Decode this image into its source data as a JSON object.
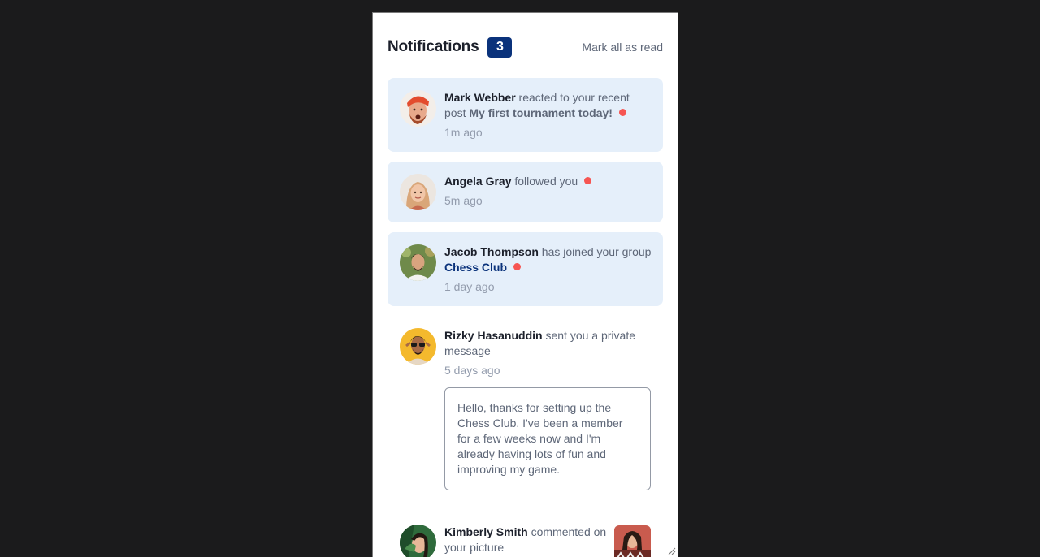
{
  "header": {
    "title": "Notifications",
    "unread_count": "3",
    "mark_all_label": "Mark all as read"
  },
  "notifications": [
    {
      "name": "Mark Webber",
      "action": " reacted to your recent post ",
      "target": "My first tournament today!",
      "time": "1m ago",
      "unread": true
    },
    {
      "name": "Angela Gray",
      "action": " followed you",
      "time": "5m ago",
      "unread": true
    },
    {
      "name": "Jacob Thompson",
      "action": " has joined your group ",
      "target": "Chess Club",
      "time": "1 day ago",
      "unread": true
    },
    {
      "name": "Rizky Hasanuddin",
      "action": " sent you a private message",
      "time": "5 days ago",
      "unread": false,
      "message": "Hello, thanks for setting up the Chess Club. I've been a member for a few weeks now and I'm already having lots of fun and improving my game."
    },
    {
      "name": "Kimberly Smith",
      "action": " commented on your picture",
      "unread": false
    }
  ],
  "colors": {
    "page_bg": "#1b1b1c",
    "unread_bg": "#e5effa",
    "badge": "#0a327b",
    "dot": "#f65552",
    "name_text": "#1c202b",
    "body_text": "#5e6778",
    "time_text": "#939cad"
  }
}
